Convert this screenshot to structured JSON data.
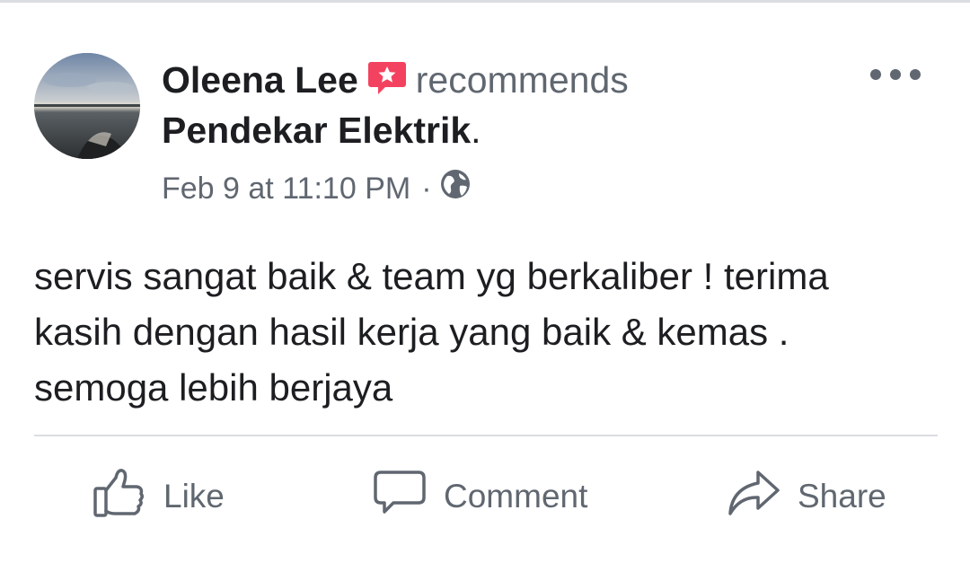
{
  "post": {
    "author": "Oleena Lee",
    "verb": "recommends",
    "page_name": "Pendekar Elektrik",
    "page_suffix": ".",
    "timestamp": "Feb 9 at 11:10 PM",
    "separator": "·",
    "privacy_icon": "globe-icon",
    "recommend_icon": "recommend-star-icon",
    "body_lines": [
      "servis sangat baik & team yg berkaliber ! terima",
      "kasih dengan hasil kerja yang baik & kemas .",
      "semoga lebih berjaya"
    ]
  },
  "actions": {
    "like_label": "Like",
    "comment_label": "Comment",
    "share_label": "Share"
  },
  "colors": {
    "text": "#1c1e21",
    "secondary_text": "#606770",
    "recommend_badge": "#f3425f",
    "divider": "#dadde1"
  }
}
